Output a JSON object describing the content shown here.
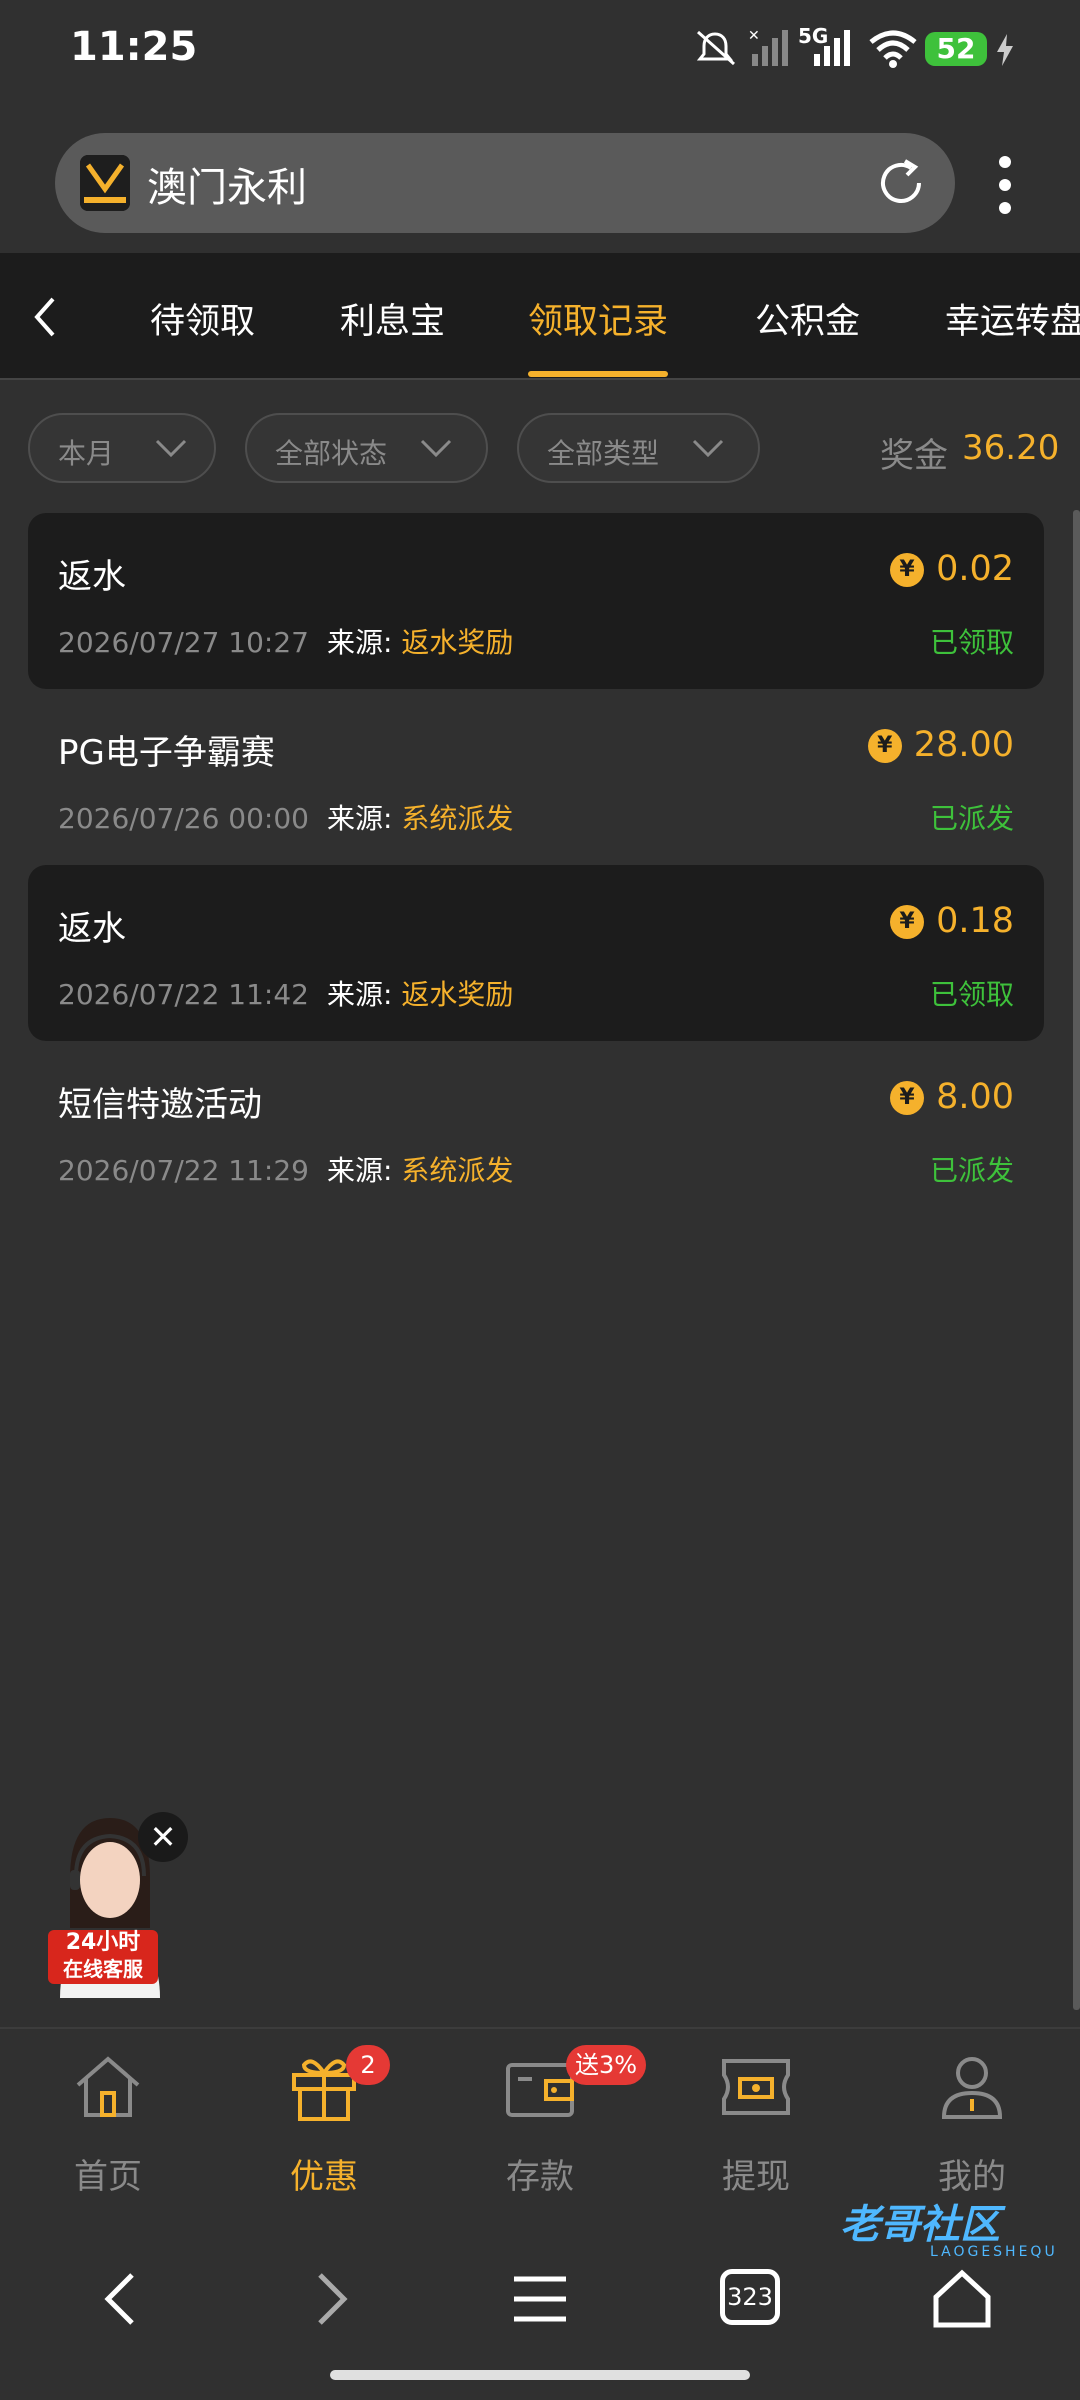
{
  "status_bar": {
    "time": "11:25",
    "network": "5G",
    "battery": "52"
  },
  "browser": {
    "site_title": "澳门永利"
  },
  "tabs": [
    {
      "label": "待领取",
      "active": false
    },
    {
      "label": "利息宝",
      "active": false
    },
    {
      "label": "领取记录",
      "active": true
    },
    {
      "label": "公积金",
      "active": false
    },
    {
      "label": "幸运转盘",
      "active": false
    }
  ],
  "filters": {
    "month": "本月",
    "status": "全部状态",
    "type": "全部类型",
    "bonus_label": "奖金",
    "bonus_amount": "36.20"
  },
  "records": [
    {
      "title": "返水",
      "amount": "0.02",
      "date": "2026/07/27 10:27",
      "source_label": "来源:",
      "source": "返水奖励",
      "status": "已领取"
    },
    {
      "title": "PG电子争霸赛",
      "amount": "28.00",
      "date": "2026/07/26 00:00",
      "source_label": "来源:",
      "source": "系统派发",
      "status": "已派发"
    },
    {
      "title": "返水",
      "amount": "0.18",
      "date": "2026/07/22 11:42",
      "source_label": "来源:",
      "source": "返水奖励",
      "status": "已领取"
    },
    {
      "title": "短信特邀活动",
      "amount": "8.00",
      "date": "2026/07/22 11:29",
      "source_label": "来源:",
      "source": "系统派发",
      "status": "已派发"
    }
  ],
  "support": {
    "line1": "24小时",
    "line2": "在线客服",
    "close": "✕"
  },
  "bottom_nav": [
    {
      "label": "首页",
      "icon": "home-icon",
      "active": false
    },
    {
      "label": "优惠",
      "icon": "gift-icon",
      "active": true,
      "badge": "2"
    },
    {
      "label": "存款",
      "icon": "wallet-icon",
      "active": false,
      "badge": "送3%"
    },
    {
      "label": "提现",
      "icon": "cash-icon",
      "active": false
    },
    {
      "label": "我的",
      "icon": "user-icon",
      "active": false
    }
  ],
  "system_nav": {
    "tabs_count": "323"
  },
  "watermark": {
    "text": "老哥社区",
    "sub": "LAOGESHEQU"
  },
  "colors": {
    "accent": "#f5b12c",
    "success": "#3ec13b",
    "background": "#303030",
    "card": "#1c1c1c"
  }
}
